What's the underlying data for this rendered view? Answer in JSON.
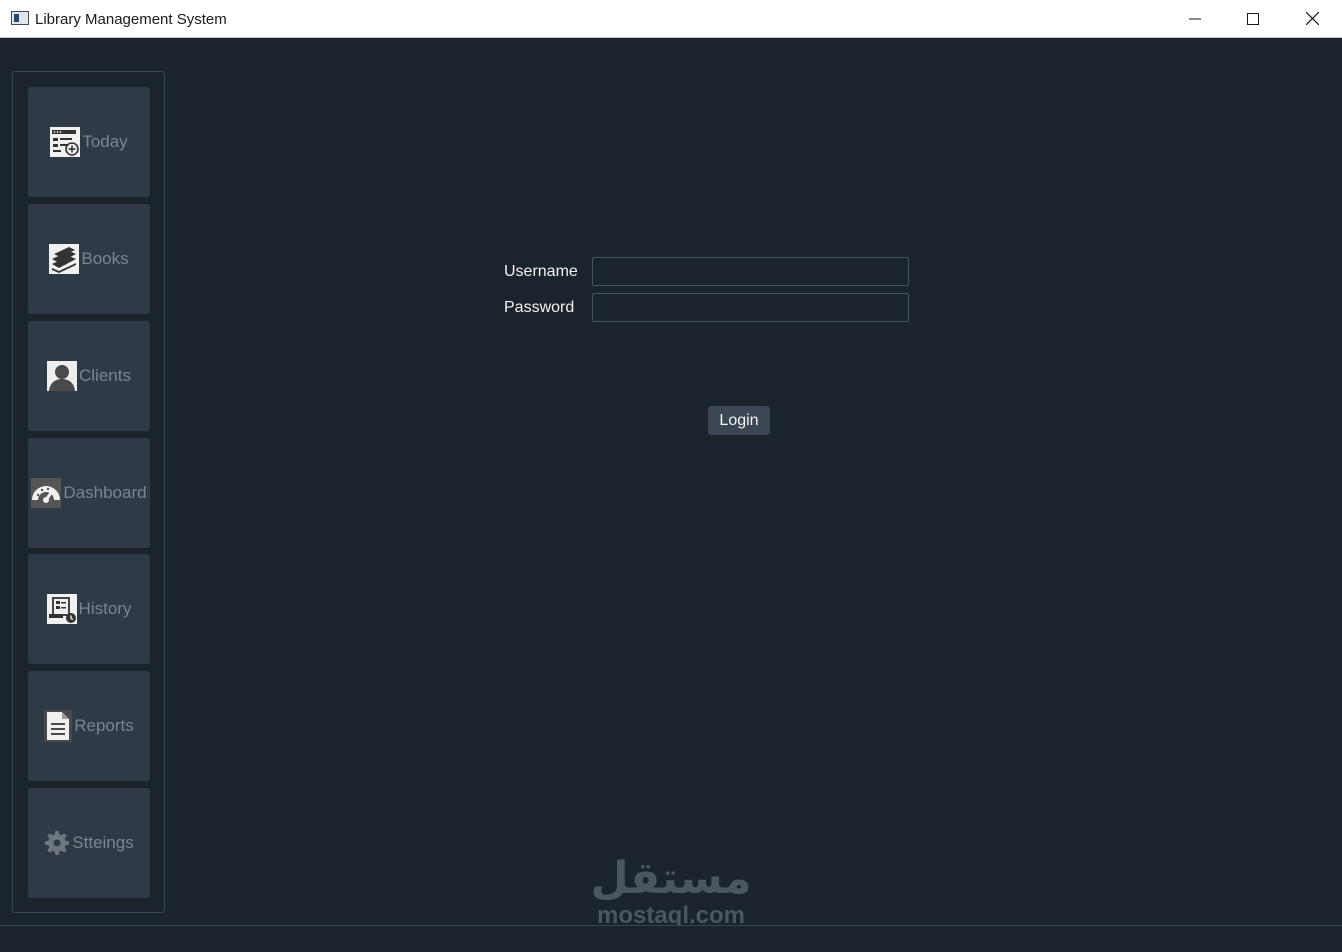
{
  "window": {
    "title": "Library Management System"
  },
  "sidebar": {
    "items": [
      {
        "label": "Today",
        "icon": "calendar-add-icon"
      },
      {
        "label": "Books",
        "icon": "books-icon"
      },
      {
        "label": "Clients",
        "icon": "user-icon"
      },
      {
        "label": "Dashboard",
        "icon": "gauge-icon"
      },
      {
        "label": "History",
        "icon": "history-icon"
      },
      {
        "label": "Reports",
        "icon": "document-icon"
      },
      {
        "label": "Stteings",
        "icon": "gear-icon"
      }
    ]
  },
  "login": {
    "username_label": "Username",
    "username_value": "",
    "password_label": "Password",
    "password_value": "",
    "button_label": "Login"
  },
  "watermark": {
    "arabic": "مستقل",
    "text": "mostaql.com"
  },
  "colors": {
    "background": "#1b232c",
    "nav_button": "#2e3a45",
    "nav_text": "#7b858f",
    "form_text": "#f2f2f2",
    "login_button": "#3a4652"
  }
}
